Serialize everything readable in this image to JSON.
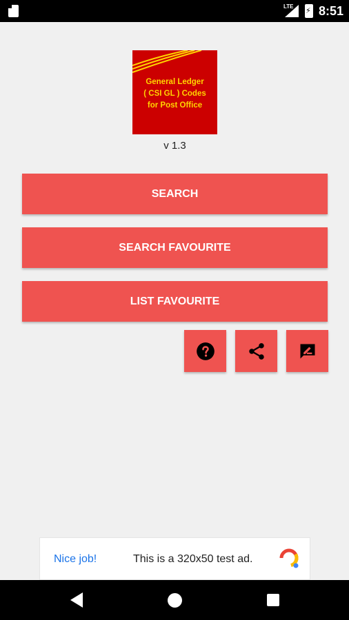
{
  "status_bar": {
    "network_label": "LTE",
    "time": "8:51"
  },
  "logo": {
    "line1": "General Ledger",
    "line2": "( CSI GL ) Codes",
    "line3": "for Post Office",
    "background_color": "#cc0000",
    "text_color": "#ffd400"
  },
  "version": "v 1.3",
  "buttons": {
    "search": "SEARCH",
    "search_favourite": "SEARCH FAVOURITE",
    "list_favourite": "LIST FAVOURITE",
    "color": "#ef5350"
  },
  "icon_buttons": [
    "help-icon",
    "share-icon",
    "feedback-icon"
  ],
  "ad": {
    "title": "Nice job!",
    "text": "This is a 320x50 test ad."
  },
  "nav": [
    "back-icon",
    "home-icon",
    "recents-icon"
  ]
}
